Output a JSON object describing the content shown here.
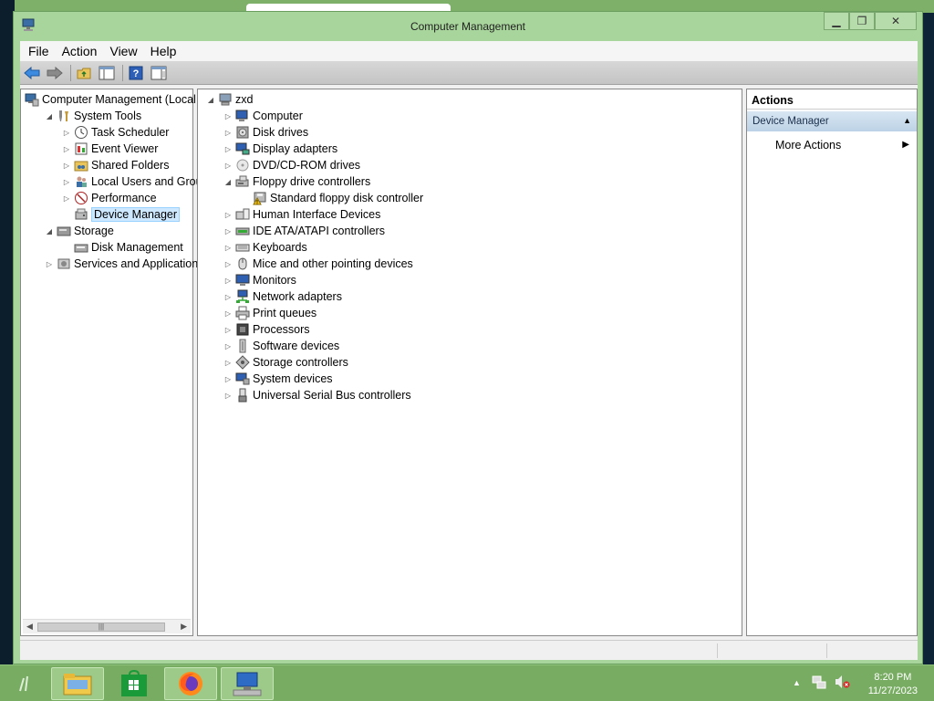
{
  "window": {
    "title": "Computer Management"
  },
  "menu": [
    "File",
    "Action",
    "View",
    "Help"
  ],
  "left_tree": {
    "root": "Computer Management (Local",
    "items": [
      {
        "label": "System Tools",
        "level": 1,
        "expander": "expanded",
        "icon": "tools-icon"
      },
      {
        "label": "Task Scheduler",
        "level": 2,
        "expander": "collapsed",
        "icon": "clock-icon"
      },
      {
        "label": "Event Viewer",
        "level": 2,
        "expander": "collapsed",
        "icon": "event-viewer-icon"
      },
      {
        "label": "Shared Folders",
        "level": 2,
        "expander": "collapsed",
        "icon": "shared-folder-icon"
      },
      {
        "label": "Local Users and Groups",
        "level": 2,
        "expander": "collapsed",
        "icon": "users-icon"
      },
      {
        "label": "Performance",
        "level": 2,
        "expander": "collapsed",
        "icon": "performance-icon"
      },
      {
        "label": "Device Manager",
        "level": 2,
        "expander": "none",
        "icon": "device-manager-icon",
        "selected": true
      },
      {
        "label": "Storage",
        "level": 1,
        "expander": "expanded",
        "icon": "storage-icon"
      },
      {
        "label": "Disk Management",
        "level": 2,
        "expander": "none",
        "icon": "disk-management-icon"
      },
      {
        "label": "Services and Applications",
        "level": 1,
        "expander": "collapsed",
        "icon": "services-icon"
      }
    ]
  },
  "device_tree": {
    "root": "zxd",
    "items": [
      {
        "label": "Computer",
        "level": 1,
        "expander": "collapsed",
        "icon": "computer-icon"
      },
      {
        "label": "Disk drives",
        "level": 1,
        "expander": "collapsed",
        "icon": "disk-drive-icon"
      },
      {
        "label": "Display adapters",
        "level": 1,
        "expander": "collapsed",
        "icon": "display-adapter-icon"
      },
      {
        "label": "DVD/CD-ROM drives",
        "level": 1,
        "expander": "collapsed",
        "icon": "dvd-icon"
      },
      {
        "label": "Floppy drive controllers",
        "level": 1,
        "expander": "expanded",
        "icon": "floppy-controller-icon"
      },
      {
        "label": "Standard floppy disk controller",
        "level": 2,
        "expander": "none",
        "icon": "floppy-warning-icon"
      },
      {
        "label": "Human Interface Devices",
        "level": 1,
        "expander": "collapsed",
        "icon": "hid-icon"
      },
      {
        "label": "IDE ATA/ATAPI controllers",
        "level": 1,
        "expander": "collapsed",
        "icon": "ide-icon"
      },
      {
        "label": "Keyboards",
        "level": 1,
        "expander": "collapsed",
        "icon": "keyboard-icon"
      },
      {
        "label": "Mice and other pointing devices",
        "level": 1,
        "expander": "collapsed",
        "icon": "mouse-icon"
      },
      {
        "label": "Monitors",
        "level": 1,
        "expander": "collapsed",
        "icon": "monitor-icon"
      },
      {
        "label": "Network adapters",
        "level": 1,
        "expander": "collapsed",
        "icon": "network-icon"
      },
      {
        "label": "Print queues",
        "level": 1,
        "expander": "collapsed",
        "icon": "printer-icon"
      },
      {
        "label": "Processors",
        "level": 1,
        "expander": "collapsed",
        "icon": "processor-icon"
      },
      {
        "label": "Software devices",
        "level": 1,
        "expander": "collapsed",
        "icon": "software-device-icon"
      },
      {
        "label": "Storage controllers",
        "level": 1,
        "expander": "collapsed",
        "icon": "storage-controller-icon"
      },
      {
        "label": "System devices",
        "level": 1,
        "expander": "collapsed",
        "icon": "system-device-icon"
      },
      {
        "label": "Universal Serial Bus controllers",
        "level": 1,
        "expander": "collapsed",
        "icon": "usb-icon"
      }
    ]
  },
  "actions": {
    "header": "Actions",
    "section": "Device Manager",
    "more": "More Actions"
  },
  "taskbar": {
    "apps": [
      "file-explorer-icon",
      "store-icon",
      "firefox-icon",
      "computer-management-icon"
    ],
    "time": "8:20 PM",
    "date": "11/27/2023"
  },
  "colors": {
    "window_frame": "#a8d59b",
    "taskbar": "#78ac62",
    "selection": "#cde8ff"
  }
}
